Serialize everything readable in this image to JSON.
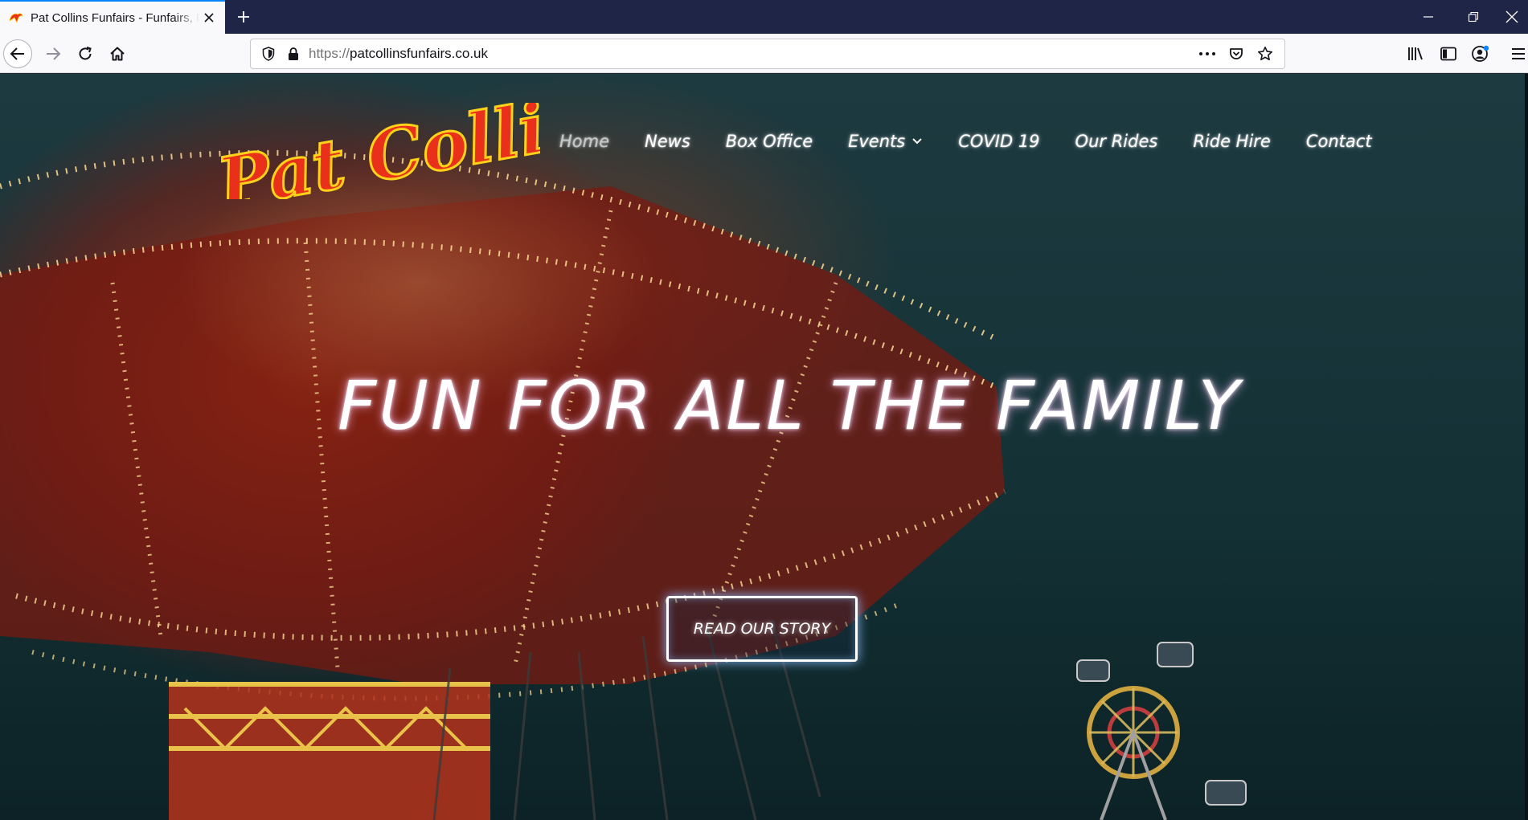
{
  "browser": {
    "tab": {
      "title": "Pat Collins Funfairs - Funfairs, R"
    },
    "url": {
      "scheme": "https://",
      "host": "patcollinsfunfairs.co.uk"
    }
  },
  "site": {
    "logo_text": "Pat Collins",
    "nav": [
      "Home",
      "News",
      "Box Office",
      "Events",
      "COVID 19",
      "Our Rides",
      "Ride Hire",
      "Contact"
    ],
    "hero_title": "FUN FOR ALL THE FAMILY",
    "cta_label": "READ OUR STORY"
  },
  "colors": {
    "accent": "#0a84ff",
    "logo_red": "#e8301a",
    "logo_yellow": "#ffd21a",
    "tabstrip": "#1f2547"
  },
  "icons": [
    "tab-favicon-icon",
    "close-icon",
    "plus-icon",
    "minimize-icon",
    "restore-icon",
    "window-close-icon",
    "back-arrow-icon",
    "forward-arrow-icon",
    "reload-icon",
    "home-icon",
    "shield-icon",
    "lock-icon",
    "more-icon",
    "pocket-icon",
    "star-icon",
    "library-icon",
    "sidebar-icon",
    "account-icon",
    "menu-icon",
    "chevron-down-icon"
  ]
}
